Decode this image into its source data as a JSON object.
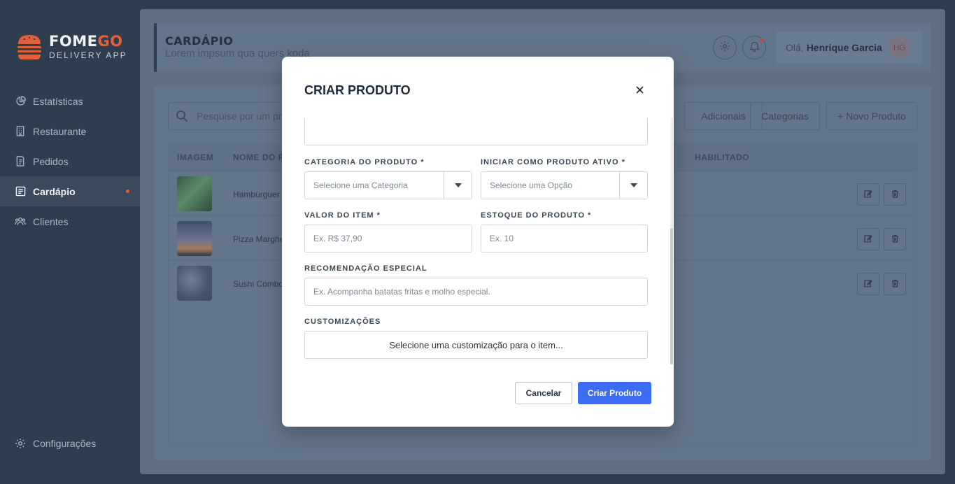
{
  "brand": {
    "name_part1": "FOME",
    "name_part2": "GO",
    "subtitle": "DELIVERY APP",
    "accent_color": "#e2603a"
  },
  "sidebar": {
    "items": [
      {
        "label": "Estatísticas",
        "icon": "pie-chart-icon"
      },
      {
        "label": "Restaurante",
        "icon": "building-icon"
      },
      {
        "label": "Pedidos",
        "icon": "receipt-icon"
      },
      {
        "label": "Cardápio",
        "icon": "menu-book-icon",
        "active": true
      },
      {
        "label": "Clientes",
        "icon": "users-icon"
      }
    ],
    "settings_label": "Configurações"
  },
  "header": {
    "title": "CARDÁPIO",
    "subtitle": "Lorem impsum qua quers koda",
    "greeting": "Olá,",
    "user_name": "Henrique Garcia",
    "avatar_initials": "HG"
  },
  "toolbar": {
    "search_placeholder": "Pesquise por um pro",
    "buttons": [
      "Adicionais",
      "Categorias",
      "+ Novo Produto"
    ]
  },
  "table": {
    "columns": [
      "IMAGEM",
      "NOME DO P",
      "HABILITADO"
    ],
    "rows": [
      {
        "name": "Hambúrguer"
      },
      {
        "name": "Pizza Marghe"
      },
      {
        "name": "Sushi Combo"
      }
    ]
  },
  "modal": {
    "title": "CRIAR PRODUTO",
    "fields": {
      "category_label": "CATEGORIA DO PRODUTO *",
      "category_placeholder": "Selecione uma Categoria",
      "active_label": "INICIAR COMO PRODUTO ATIVO *",
      "active_placeholder": "Selecione uma Opção",
      "price_label": "VALOR DO ITEM *",
      "price_placeholder": "Ex. R$ 37,90",
      "stock_label": "ESTOQUE DO PRODUTO *",
      "stock_placeholder": "Ex. 10",
      "recommendation_label": "RECOMENDAÇÃO ESPECIAL",
      "recommendation_placeholder": "Ex. Acompanha batatas fritas e molho especial.",
      "customizations_label": "CUSTOMIZAÇÕES",
      "customizations_button": "Selecione uma customização para o item..."
    },
    "cancel_label": "Cancelar",
    "create_label": "Criar Produto",
    "primary_color": "#3c6cf4"
  }
}
